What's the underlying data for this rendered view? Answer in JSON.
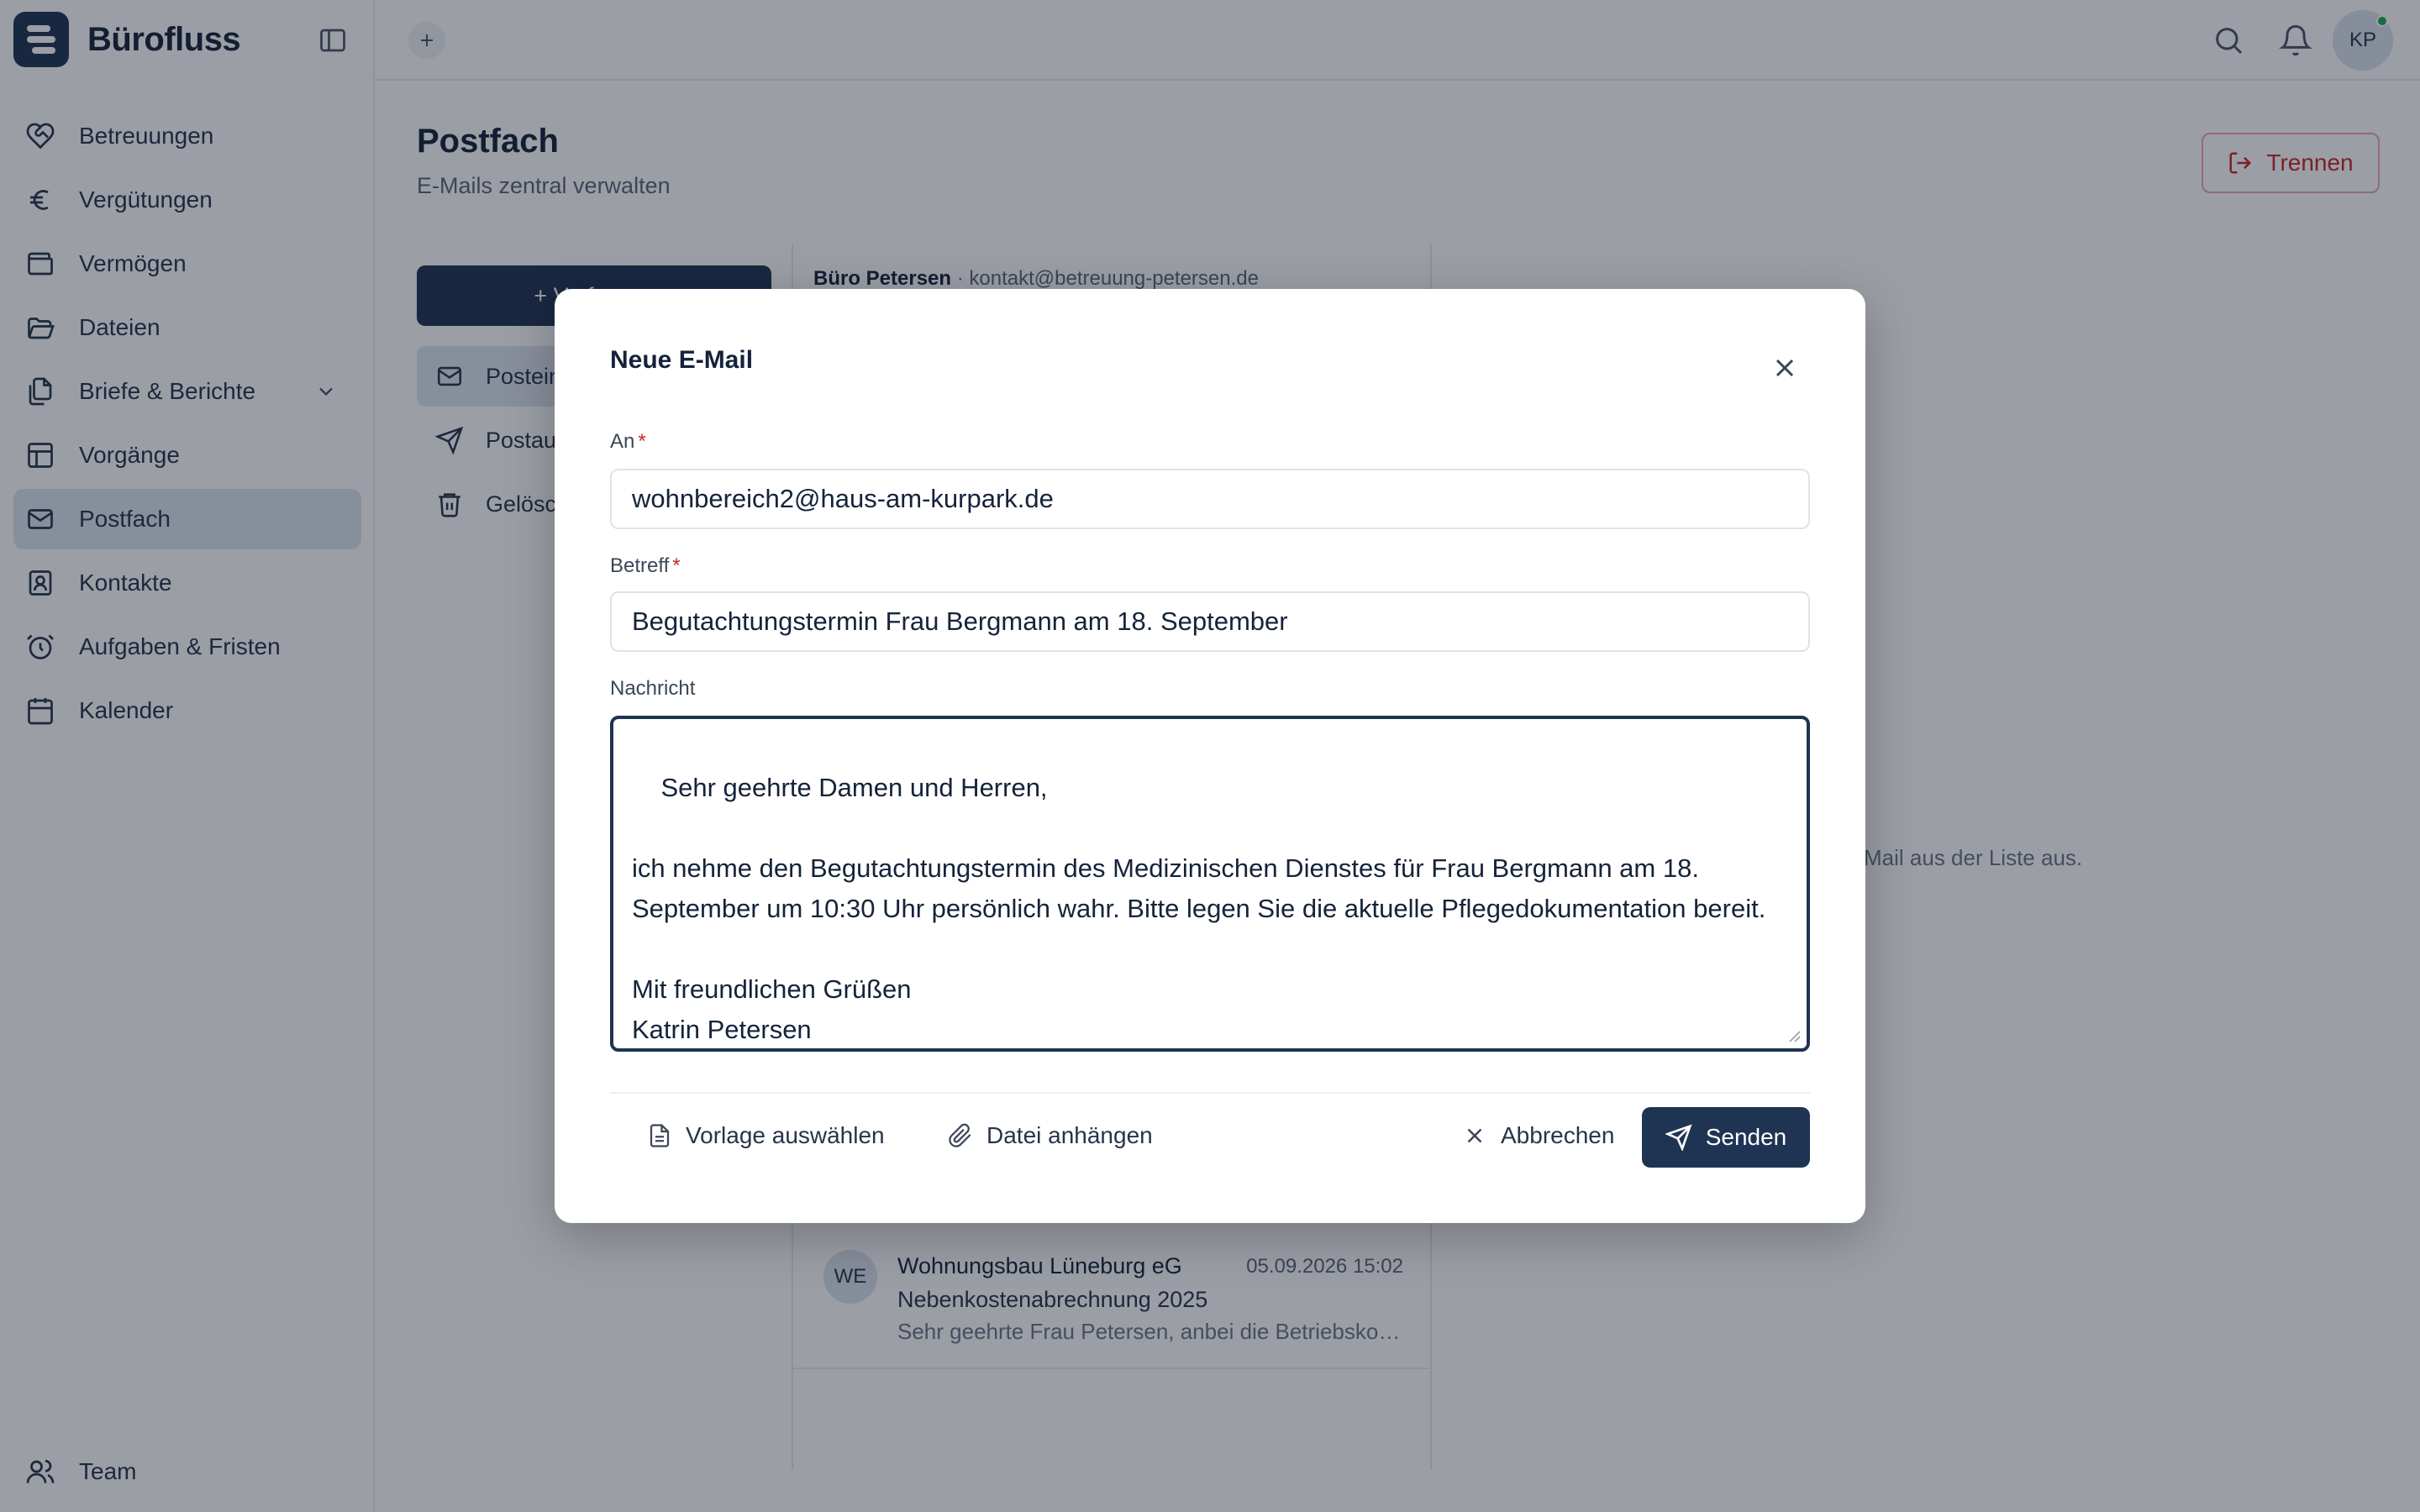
{
  "app": {
    "name": "Bürofluss"
  },
  "sidebar": {
    "items": [
      {
        "label": "Betreuungen",
        "icon": "heart-handshake-icon"
      },
      {
        "label": "Vergütungen",
        "icon": "euro-icon"
      },
      {
        "label": "Vermögen",
        "icon": "wallet-icon"
      },
      {
        "label": "Dateien",
        "icon": "folder-open-icon"
      },
      {
        "label": "Briefe & Berichte",
        "icon": "files-icon"
      },
      {
        "label": "Vorgänge",
        "icon": "table-icon"
      },
      {
        "label": "Postfach",
        "icon": "mail-icon"
      },
      {
        "label": "Kontakte",
        "icon": "contact-book-icon"
      },
      {
        "label": "Aufgaben & Fristen",
        "icon": "alarm-clock-icon"
      },
      {
        "label": "Kalender",
        "icon": "calendar-icon"
      }
    ],
    "active": "Postfach",
    "team_label": "Team"
  },
  "topbar": {
    "avatar_initials": "KP"
  },
  "page": {
    "title": "Postfach",
    "subtitle": "E-Mails zentral verwalten",
    "disconnect_label": "Trennen"
  },
  "mailbox": {
    "compose_label": "+ Verfassen",
    "folders": [
      "Posteingang",
      "Postausgang",
      "Gelöscht"
    ],
    "account_name": "Büro Petersen",
    "account_email": "· kontakt@betreuung-petersen.de",
    "messages": [
      {
        "initials": "WE",
        "from": "Wohnungsbau Lüneburg eG",
        "date": "05.09.2026 15:02",
        "subject": "Nebenkostenabrechnung 2025",
        "preview": "Sehr geehrte Frau Petersen, anbei die Betriebskos..."
      }
    ],
    "empty_hint": "Mail aus der Liste aus."
  },
  "dialog": {
    "title": "Neue E-Mail",
    "to_label": "An",
    "to_value": "wohnbereich2@haus-am-kurpark.de",
    "subject_label": "Betreff",
    "subject_value": "Begutachtungstermin Frau Bergmann am 18. September",
    "message_label": "Nachricht",
    "message_value": "Sehr geehrte Damen und Herren,\n\nich nehme den Begutachtungstermin des Medizinischen Dienstes für Frau Bergmann am 18. September um 10:30 Uhr persönlich wahr. Bitte legen Sie die aktuelle Pflegedokumentation bereit.\n\nMit freundlichen Grüßen\nKatrin Petersen",
    "required_mark": "*",
    "template_label": "Vorlage auswählen",
    "attach_label": "Datei anhängen",
    "cancel_label": "Abbrechen",
    "send_label": "Senden"
  }
}
